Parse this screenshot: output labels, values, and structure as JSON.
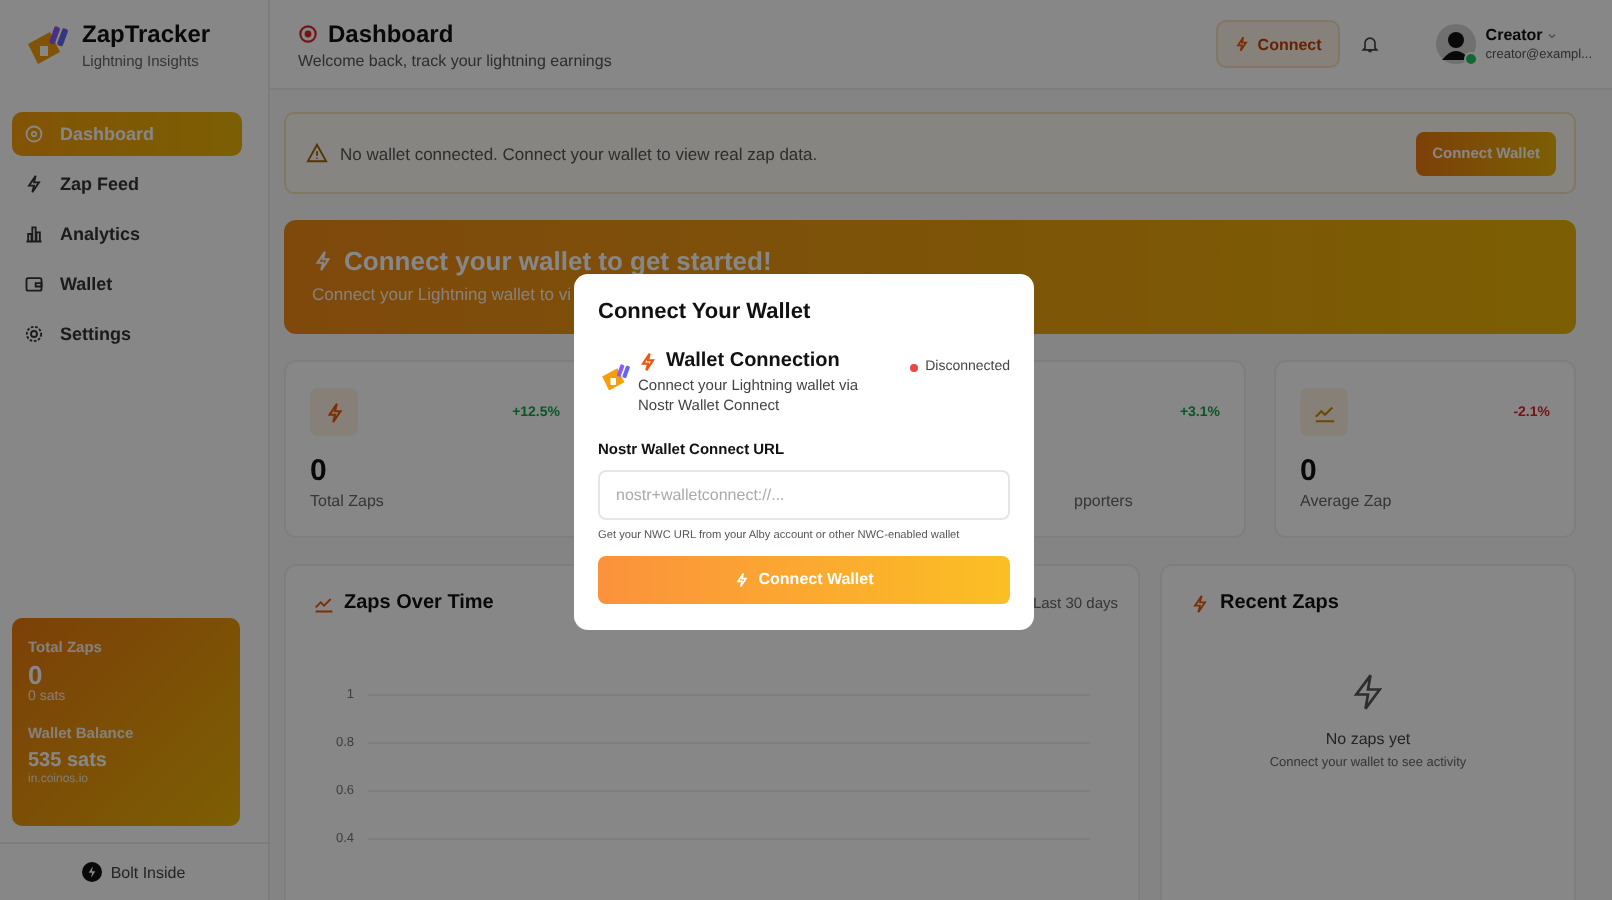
{
  "app": {
    "name": "ZapTracker",
    "tagline": "Lightning Insights"
  },
  "header": {
    "title": "Dashboard",
    "subtitle": "Welcome back, track your lightning earnings",
    "connect_button": "Connect",
    "user": {
      "name": "Creator",
      "email": "creator@exampl...",
      "online": true
    }
  },
  "sidebar": {
    "items": [
      {
        "label": "Dashboard",
        "selected": true
      },
      {
        "label": "Zap Feed",
        "selected": false
      },
      {
        "label": "Analytics",
        "selected": false
      },
      {
        "label": "Wallet",
        "selected": false
      },
      {
        "label": "Settings",
        "selected": false
      }
    ],
    "summary": {
      "total_label": "Total Zaps",
      "total_value": "0",
      "total_sats": "0 sats",
      "balance_label": "Wallet Balance",
      "balance_value": "535 sats",
      "balance_source": "in.coinos.io"
    },
    "footer": "Bolt Inside"
  },
  "alert": {
    "text": "No wallet connected. Connect your wallet to view real zap data.",
    "button": "Connect Wallet"
  },
  "banner": {
    "title": "Connect your wallet to get started!",
    "subtitle": "Connect your Lightning wallet to vi"
  },
  "stats": [
    {
      "value": "0",
      "label": "Total Zaps",
      "change": "+12.5%",
      "kind": "up"
    },
    {
      "label": "pporters",
      "change": "+3.1%",
      "kind": "up"
    },
    {
      "value": "0",
      "label": "Average Zap",
      "change": "-2.1%",
      "kind": "down"
    }
  ],
  "chart": {
    "title": "Zaps Over Time",
    "range": "Last 30 days",
    "y_ticks": [
      "1",
      "0.8",
      "0.6",
      "0.4"
    ]
  },
  "recent": {
    "title": "Recent Zaps",
    "empty_title": "No zaps yet",
    "empty_text": "Connect your wallet to see activity"
  },
  "modal": {
    "title": "Connect Your Wallet",
    "section_title": "Wallet Connection",
    "description": "Connect your Lightning wallet via Nostr Wallet Connect",
    "status": "Disconnected",
    "connected": false,
    "field_label": "Nostr Wallet Connect URL",
    "placeholder": "nostr+walletconnect://...",
    "help": "Get your NWC URL from your Alby account or other NWC-enabled wallet",
    "button": "Connect Wallet"
  }
}
